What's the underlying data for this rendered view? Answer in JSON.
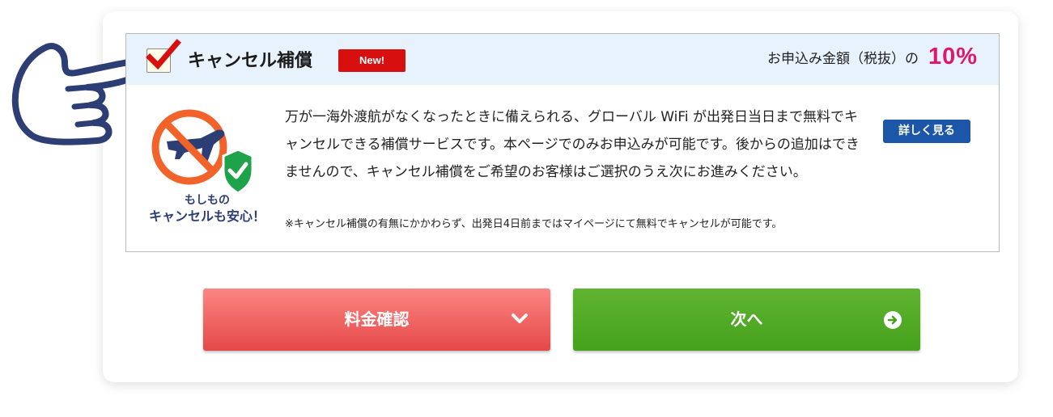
{
  "option": {
    "title": "キャンセル補償",
    "badge": "New!",
    "checked": true,
    "price_label": "お申込み金額（税抜）の",
    "price_value": "10%",
    "description": "万が一海外渡航がなくなったときに備えられる、グローバル WiFi が出発日当日まで無料でキャンセルできる補償サービスです。本ページでのみお申込みが可能です。後からの追加はできませんので、キャンセル補償をご希望のお客様はご選択のうえ次にお進みください。",
    "note": "※キャンセル補償の有無にかかわらず、出発日4日前まではマイページにて無料でキャンセルが可能です。",
    "details_label": "詳しく見る",
    "illustration_caption_1": "もしもの",
    "illustration_caption_2": "キャンセルも安心！"
  },
  "actions": {
    "price_check_label": "料金確認",
    "next_label": "次へ"
  },
  "colors": {
    "price_accent": "#e0166d",
    "badge_red": "#d80f0f",
    "details_blue": "#1b56a8",
    "price_button": "#e54848",
    "next_button": "#45a21c",
    "header_bg": "#e7f2fd"
  },
  "icons": {
    "pointing_hand": "pointing-hand-icon",
    "check": "checkmark-icon",
    "no_flight": "no-flight-icon",
    "shield": "shield-check-icon",
    "chevron": "chevron-down-icon",
    "arrow": "arrow-right-circle-icon"
  }
}
